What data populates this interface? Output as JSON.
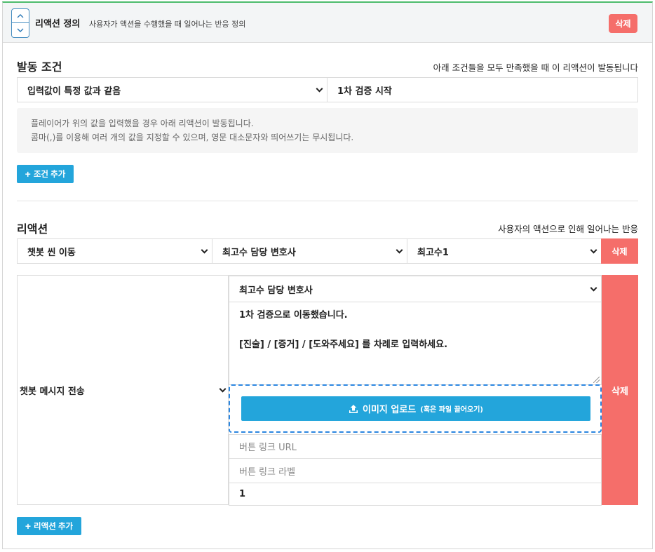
{
  "header": {
    "sort_up_icon": "chevron-up",
    "sort_down_icon": "chevron-down",
    "title": "리액션 정의",
    "subtitle": "사용자가 액션을 수행했을 때 일어나는 반응 정의",
    "delete_label": "삭제",
    "accent_color": "#4cbb6c",
    "danger_color": "#f56e6a",
    "primary_color": "#23a5db"
  },
  "trigger": {
    "title": "발동 조건",
    "hint": "아래 조건들을 모두 만족했을 때 이 리액션이 발동됩니다",
    "condition_type": "입력값이 특정 값과 같음",
    "condition_value": "1차 검증 시작",
    "info_line1": "플레이어가 위의 값을 입력했을 경우 아래 리액션이 발동됩니다.",
    "info_line2": "콤마(,)를 이용해 여러 개의 값을 지정할 수 있으며, 영문 대소문자와 띄어쓰기는 무시됩니다.",
    "add_label": "조건 추가"
  },
  "actions": {
    "title": "리액션",
    "hint": "사용자의 액션으로 인해 일어나는 반응",
    "row1": {
      "type": "챗봇 씬 이동",
      "bot": "최고수 담당 변호사",
      "scene": "최고수1",
      "delete_label": "삭제"
    },
    "row2": {
      "type": "챗봇 메시지 전송",
      "bot": "최고수 담당 변호사",
      "message_line1": "1차 검증으로 이동했습니다.",
      "message_line2": "[진술] / [증거] / [도와주세요] 를 차례로 입력하세요.",
      "upload_label": "이미지 업로드",
      "upload_hint": "(혹은 파일 끌어오기)",
      "link_url_placeholder": "버튼 링크 URL",
      "link_label_placeholder": "버튼 링크 라벨",
      "delay_value": "1",
      "delete_label": "삭제"
    },
    "add_label": "리액션 추가"
  }
}
